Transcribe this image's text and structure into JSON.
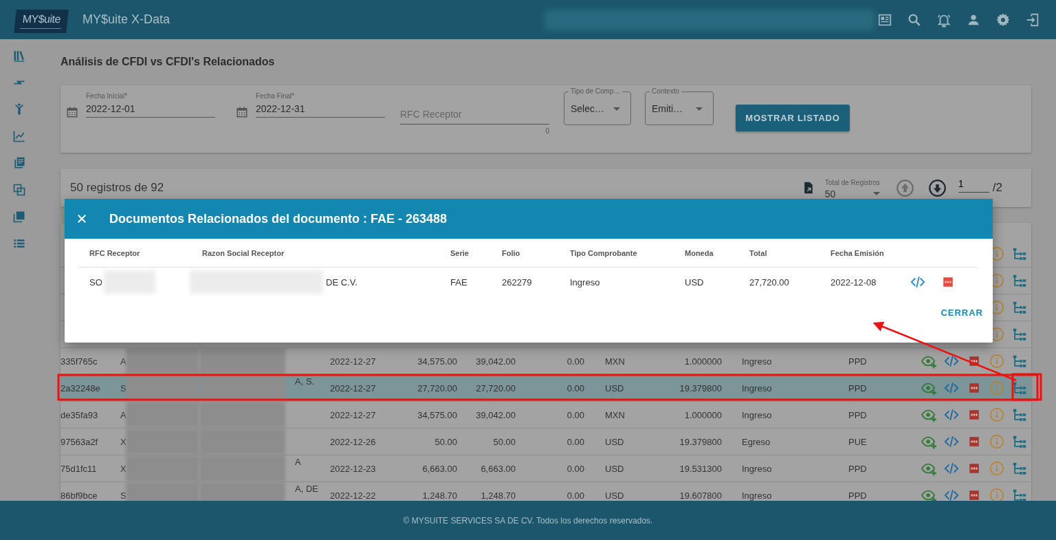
{
  "app": {
    "logo": "MY$uite",
    "title": "MY$uite X-Data"
  },
  "page_title": "Análisis de CFDI vs CFDI's Relacionados",
  "filters": {
    "fecha_inicial": {
      "label": "Fecha Inicial*",
      "value": "2022-12-01"
    },
    "fecha_final": {
      "label": "Fecha Final*",
      "value": "2022-12-31"
    },
    "rfc_receptor": {
      "placeholder": "RFC Receptor",
      "counter": "0"
    },
    "tipo_comprobante": {
      "label": "Tipo de Comp…",
      "value": "Selec…"
    },
    "contexto": {
      "label": "Contexto",
      "value": "Emiti…"
    },
    "button": "MOSTRAR LISTADO"
  },
  "results": {
    "summary": "50 registros de 92",
    "page_size": {
      "label": "Total de Registros",
      "value": "50"
    },
    "page": "1",
    "page_total": "/2"
  },
  "table": {
    "rows": [
      {
        "kind": "covered"
      },
      {
        "kind": "covered"
      },
      {
        "kind": "covered"
      },
      {
        "kind": "covered"
      },
      {
        "kind": "data",
        "selected": false,
        "column_1": "335f765c",
        "column_2": "A",
        "column_4": "2022-12-27",
        "column_5": "34,575.00",
        "column_6": "39,042.00",
        "column_7": "0.00",
        "column_8": "MXN",
        "column_9": "1.000000",
        "column_10": "Ingreso",
        "column_11": "PPD"
      },
      {
        "kind": "data",
        "selected": true,
        "column_1": "2a32248e",
        "column_2": "S",
        "column_3": "A, S.",
        "column_4": "2022-12-27",
        "column_5": "27,720.00",
        "column_6": "27,720.00",
        "column_7": "0.00",
        "column_8": "USD",
        "column_9": "19.379800",
        "column_10": "Ingreso",
        "column_11": "PPD"
      },
      {
        "kind": "data",
        "selected": false,
        "column_1": "de35fa93",
        "column_2": "A",
        "column_4": "2022-12-27",
        "column_5": "34,575.00",
        "column_6": "39,042.00",
        "column_7": "0.00",
        "column_8": "MXN",
        "column_9": "1.000000",
        "column_10": "Ingreso",
        "column_11": "PPD"
      },
      {
        "kind": "data",
        "selected": false,
        "column_1": "97563a2f",
        "column_2": "X",
        "column_4": "2022-12-26",
        "column_5": "50.00",
        "column_6": "50.00",
        "column_7": "0.00",
        "column_8": "USD",
        "column_9": "19.379800",
        "column_10": "Egreso",
        "column_11": "PUE"
      },
      {
        "kind": "data",
        "selected": false,
        "column_1": "75d1fc11",
        "column_2": "X",
        "column_3": "A",
        "column_4": "2022-12-23",
        "column_5": "6,663.00",
        "column_6": "6,663.00",
        "column_7": "0.00",
        "column_8": "USD",
        "column_9": "19.531300",
        "column_10": "Ingreso",
        "column_11": "PPD"
      },
      {
        "kind": "data",
        "selected": false,
        "column_1": "86bf9bce",
        "column_2": "S",
        "column_3": "A, DE",
        "column_4": "2022-12-22",
        "column_5": "1,248.70",
        "column_6": "1,248.70",
        "column_7": "0.00",
        "column_8": "USD",
        "column_9": "19.607800",
        "column_10": "Ingreso",
        "column_11": "PPD"
      }
    ]
  },
  "dialog": {
    "title": "Documentos Relacionados del documento : FAE - 263488",
    "columns": [
      "RFC Receptor",
      "Razon Social Receptor",
      "Serie",
      "Folio",
      "Tipo Comprobante",
      "Moneda",
      "Total",
      "Fecha Emisión"
    ],
    "rows": [
      {
        "cells": [
          "SO",
          "DE C.V.",
          "FAE",
          "262279",
          "Ingreso",
          "USD",
          "27,720.00",
          "2022-12-08"
        ]
      }
    ],
    "button": "CERRAR"
  },
  "footer": "© MYSUITE SERVICES SA DE CV. Todos los derechos reservados."
}
